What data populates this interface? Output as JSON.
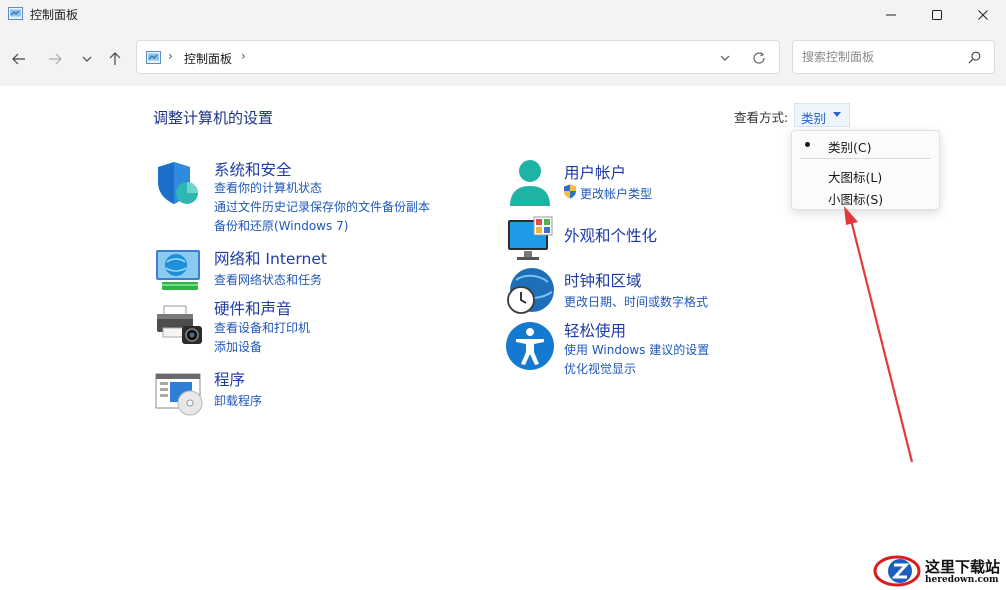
{
  "window": {
    "title": "控制面板",
    "controls": {
      "minimize_icon": "minimize-icon",
      "maximize_icon": "maximize-icon",
      "close_icon": "close-icon"
    }
  },
  "nav": {
    "breadcrumb": [
      "控制面板"
    ],
    "search_placeholder": "搜索控制面板",
    "icons": [
      "back-arrow-icon",
      "forward-arrow-icon",
      "chevron-down-icon",
      "up-arrow-icon",
      "refresh-icon",
      "search-icon"
    ]
  },
  "content": {
    "title": "调整计算机的设置",
    "view_by_label": "查看方式:",
    "view_by_value": "类别",
    "left_categories": [
      {
        "icon": "shield-icon",
        "title": "系统和安全",
        "links": [
          "查看你的计算机状态",
          "通过文件历史记录保存你的文件备份副本",
          "备份和还原(Windows 7)"
        ]
      },
      {
        "icon": "network-globe-icon",
        "title": "网络和 Internet",
        "links": [
          "查看网络状态和任务"
        ]
      },
      {
        "icon": "printer-icon",
        "title": "硬件和声音",
        "links": [
          "查看设备和打印机",
          "添加设备"
        ]
      },
      {
        "icon": "programs-disc-icon",
        "title": "程序",
        "links": [
          "卸载程序"
        ]
      }
    ],
    "right_categories": [
      {
        "icon": "user-accounts-icon",
        "title": "用户帐户",
        "links": [
          "更改帐户类型"
        ]
      },
      {
        "icon": "monitor-personalize-icon",
        "title": "外观和个性化",
        "links": []
      },
      {
        "icon": "clock-globe-icon",
        "title": "时钟和区域",
        "links": [
          "更改日期、时间或数字格式"
        ]
      },
      {
        "icon": "accessibility-icon",
        "title": "轻松使用",
        "links": [
          "使用 Windows 建议的设置",
          "优化视觉显示"
        ]
      }
    ]
  },
  "view_menu": {
    "items": [
      "类别(C)",
      "大图标(L)",
      "小图标(S)"
    ],
    "selected": "类别(C)"
  },
  "colors": {
    "link": "#1f58b8",
    "heading": "#1e3ba8",
    "annotation_arrow": "#e03a3a"
  },
  "watermark": {
    "cn": "这里下载站",
    "en": "heredown.com"
  }
}
